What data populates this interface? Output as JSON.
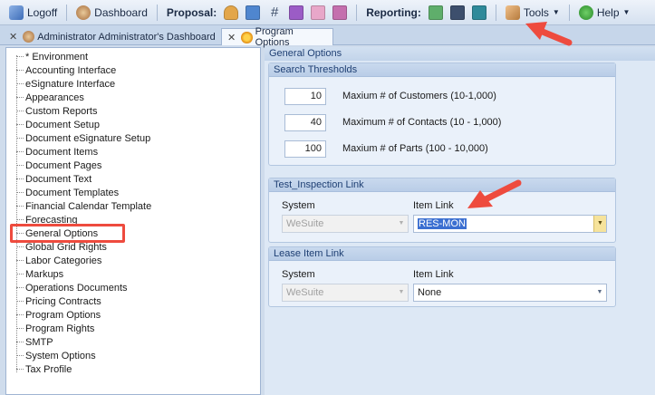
{
  "toolbar": {
    "logoff": "Logoff",
    "dashboard": "Dashboard",
    "proposal_label": "Proposal:",
    "reporting_label": "Reporting:",
    "tools": "Tools",
    "help": "Help"
  },
  "tabs": [
    {
      "label": "Administrator Administrator's Dashboard"
    },
    {
      "label": "Program Options"
    }
  ],
  "tree": {
    "items": [
      "* Environment",
      "Accounting Interface",
      "eSignature Interface",
      "Appearances",
      "Custom Reports",
      "Document Setup",
      "Document eSignature Setup",
      "Document Items",
      "Document Pages",
      "Document Text",
      "Document Templates",
      "Financial Calendar Template",
      "Forecasting",
      "General Options",
      "Global Grid Rights",
      "Labor Categories",
      "Markups",
      "Operations Documents",
      "Pricing Contracts",
      "Program Options",
      "Program Rights",
      "SMTP",
      "System Options",
      "Tax Profile"
    ]
  },
  "panel": {
    "title": "General Options",
    "search": {
      "title": "Search Thresholds",
      "rows": [
        {
          "value": "10",
          "label": "Maxium # of Customers (10-1,000)"
        },
        {
          "value": "40",
          "label": "Maximum # of Contacts (10 - 1,000)"
        },
        {
          "value": "100",
          "label": "Maxium # of Parts (100 - 10,000)"
        }
      ]
    },
    "inspection": {
      "title": "Test_Inspection Link",
      "system_header": "System",
      "item_header": "Item Link",
      "system_value": "WeSuite",
      "item_value": "RES-MON"
    },
    "lease": {
      "title": "Lease Item Link",
      "system_header": "System",
      "item_header": "Item Link",
      "system_value": "WeSuite",
      "item_value": "None"
    }
  },
  "colors": {
    "annotation": "#ee4b3e",
    "selection": "#3b6fd1"
  }
}
